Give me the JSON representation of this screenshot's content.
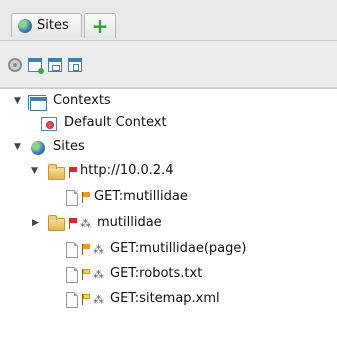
{
  "tabs": {
    "sites_label": "Sites",
    "add_label": "+"
  },
  "toolbar": {
    "buttons": [
      "options-icon",
      "new-context-icon",
      "import-context-icon",
      "export-context-icon"
    ]
  },
  "tree": {
    "contexts_label": "Contexts",
    "default_context_label": "Default Context",
    "sites_label": "Sites",
    "host_label": "http://10.0.2.4",
    "items": [
      {
        "label": "GET:mutillidae"
      },
      {
        "label": "mutillidae"
      },
      {
        "label": "GET:mutillidae(page)"
      },
      {
        "label": "GET:robots.txt"
      },
      {
        "label": "GET:sitemap.xml"
      }
    ]
  },
  "colors": {
    "accent_blue": "#3f7fb8",
    "add_green": "#2ba52b",
    "flag_orange": "#f29a1a",
    "flag_red": "#d92a2a"
  }
}
